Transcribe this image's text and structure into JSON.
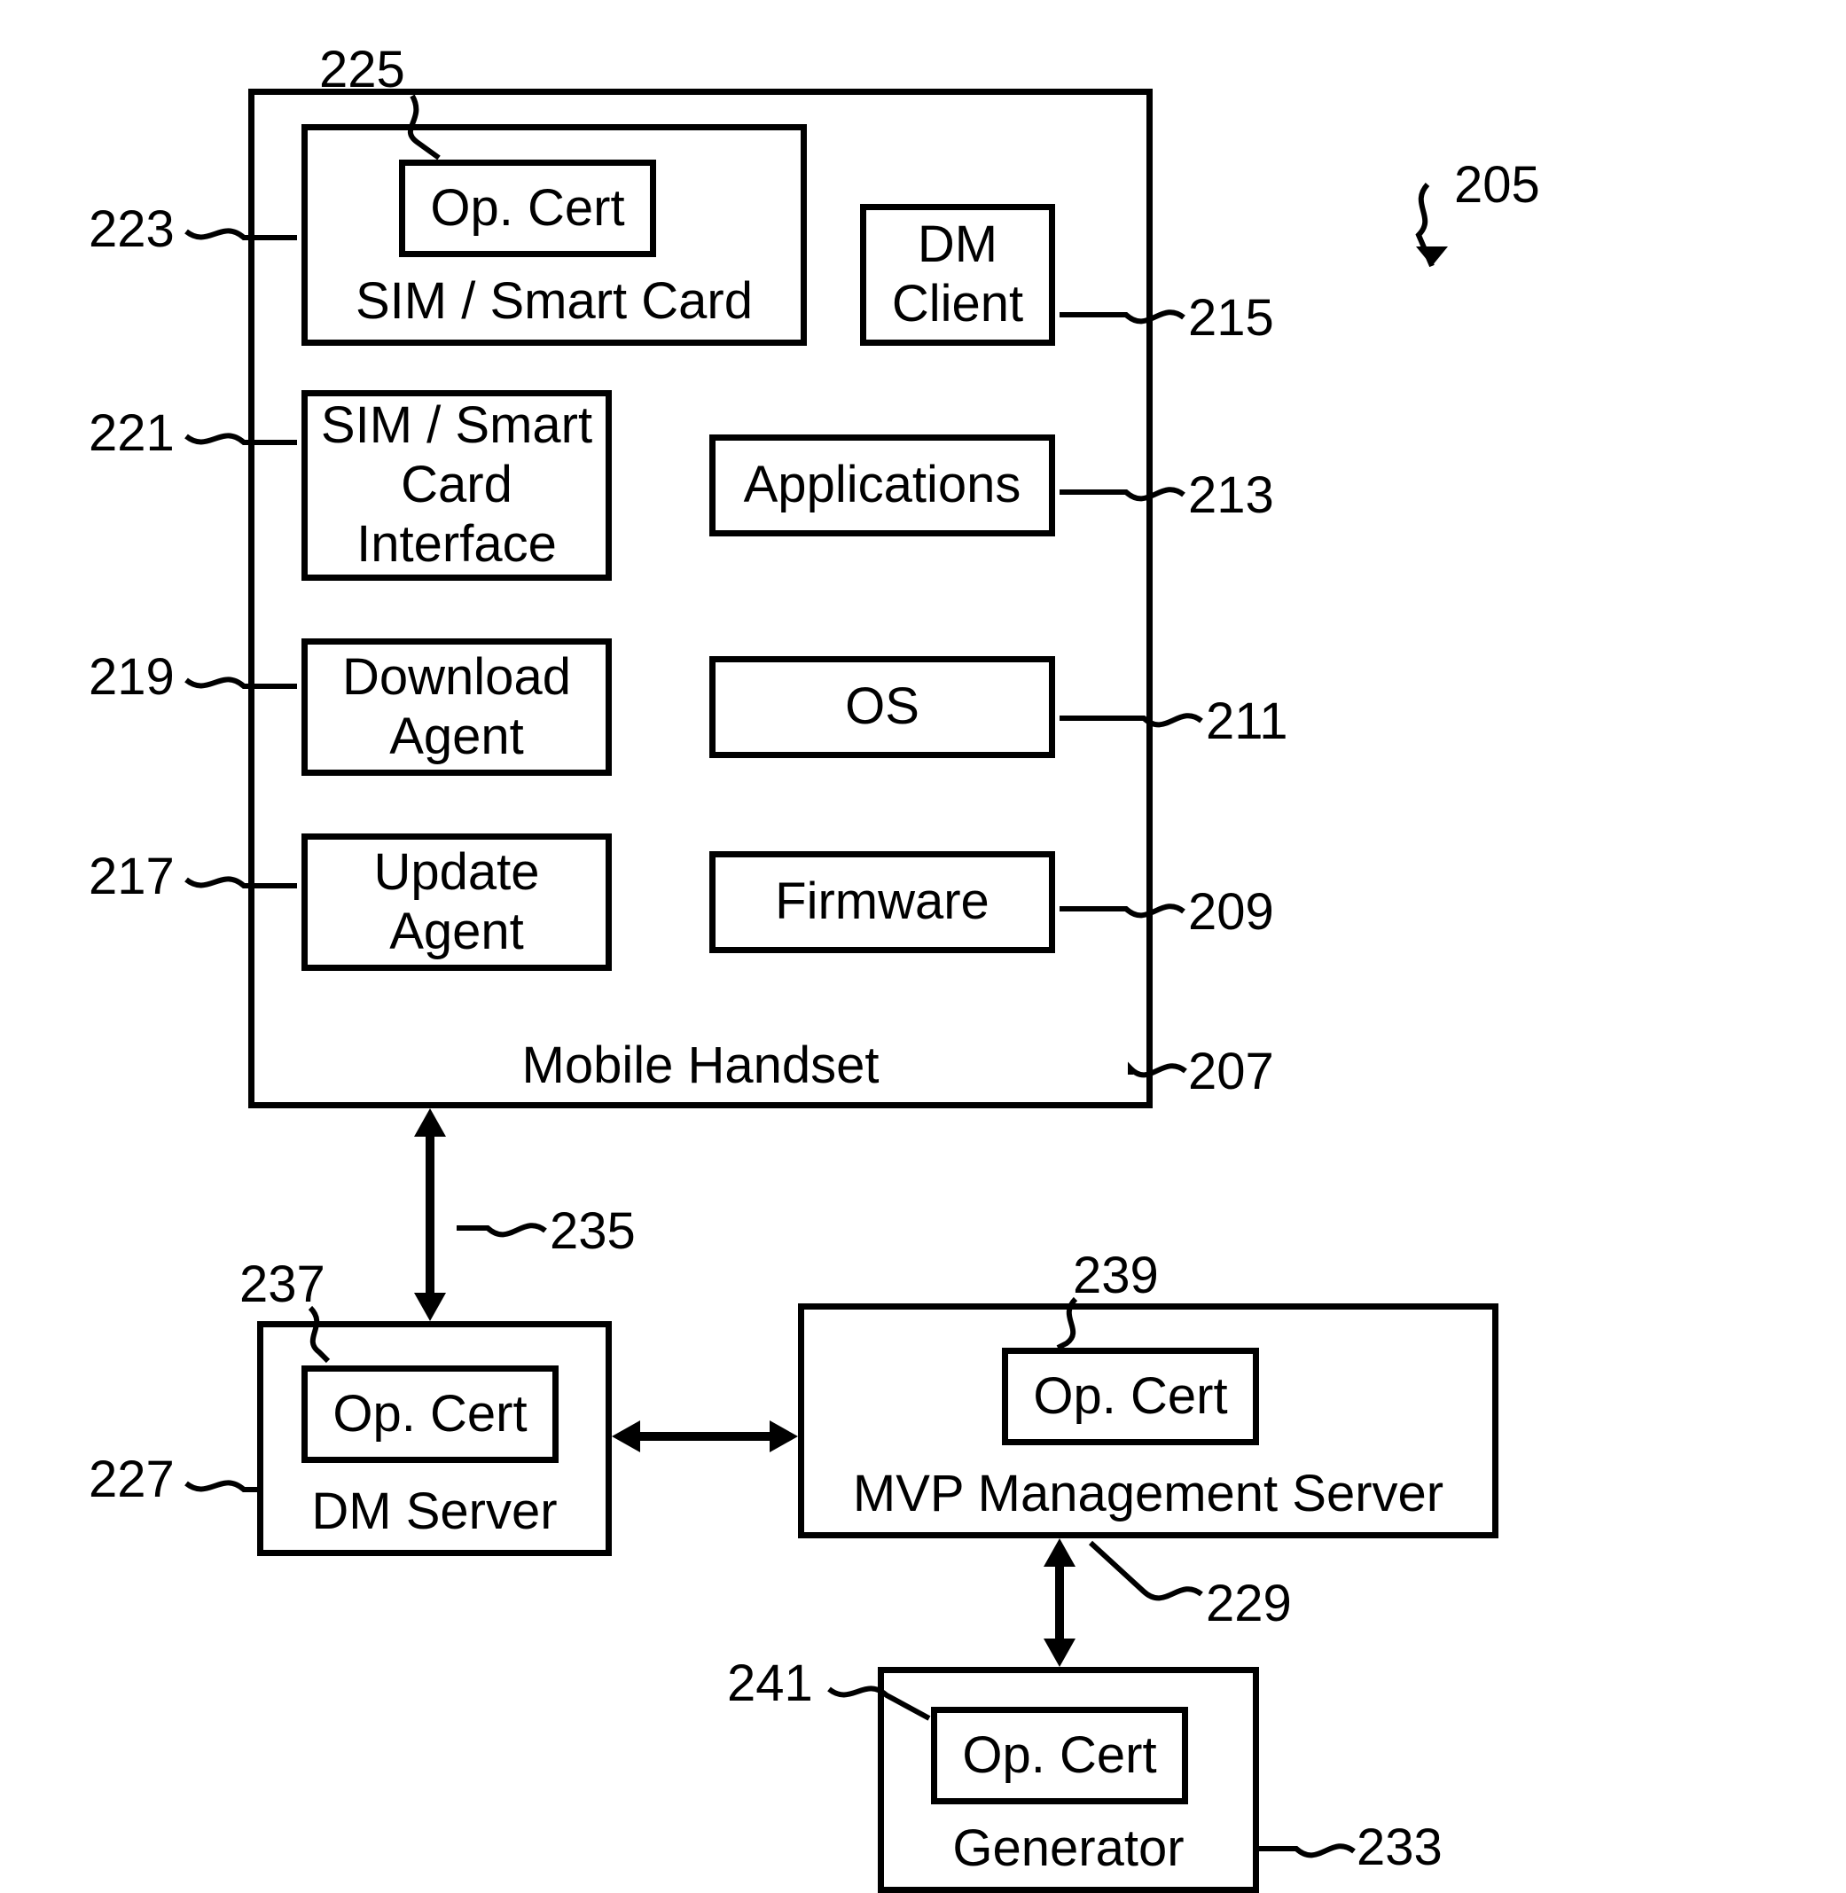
{
  "refs": {
    "r205": "205",
    "r207": "207",
    "r209": "209",
    "r211": "211",
    "r213": "213",
    "r215": "215",
    "r217": "217",
    "r219": "219",
    "r221": "221",
    "r223": "223",
    "r225": "225",
    "r227": "227",
    "r229": "229",
    "r233": "233",
    "r235": "235",
    "r237": "237",
    "r239": "239",
    "r241": "241"
  },
  "blocks": {
    "mobile_handset": "Mobile Handset",
    "sim_card": "SIM / Smart Card",
    "op_cert_sim": "Op. Cert",
    "dm_client": "DM Client",
    "sim_interface": "SIM / Smart Card Interface",
    "applications": "Applications",
    "download_agent": "Download Agent",
    "os": "OS",
    "update_agent": "Update Agent",
    "firmware": "Firmware",
    "dm_server": "DM Server",
    "op_cert_dm": "Op. Cert",
    "mvp_server": "MVP Management Server",
    "op_cert_mvp": "Op. Cert",
    "generator": "Generator",
    "op_cert_gen": "Op. Cert"
  }
}
